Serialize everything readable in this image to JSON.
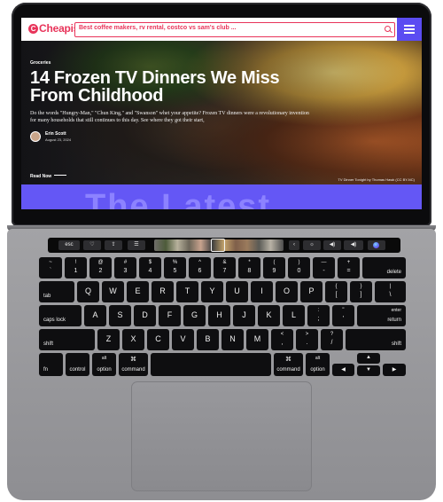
{
  "site": {
    "logo": "Cheapism",
    "logo_mark": "C",
    "search_value": "Best coffee makers, rv rental, costco vs sam's club ...",
    "accent_color": "#e8345a",
    "brand_color": "#5b4cf2"
  },
  "hero": {
    "category": "Groceries",
    "headline": "14 Frozen TV Dinners We Miss From Childhood",
    "dek": "Do the words \"Hungry-Man,\" \"Chun King,\" and \"Swanson\" whet your appetite? Frozen TV dinners were a revolutionary invention for many households that still continues to this day. See where they got their start,",
    "author": "Erin Scott",
    "date": "August 23, 2024",
    "cta": "Read Now",
    "caption": "TV Dinner Tonight by Thomas Hawk (CC BY-NC)"
  },
  "latest": {
    "heading": "The Latest"
  },
  "touch_bar": {
    "esc": "esc",
    "icons": [
      "heart-icon",
      "share-icon",
      "tabs-icon",
      "brightness-icon",
      "volume-icon",
      "mute-icon",
      "siri-icon"
    ],
    "heart": "♡",
    "share": "⇪",
    "tabs": "☰",
    "chevron": "‹",
    "brightness": "☼",
    "volume": "◀)",
    "mute": "◀)"
  },
  "keyboard": {
    "row1": [
      {
        "top": "~",
        "bot": "`"
      },
      {
        "top": "!",
        "bot": "1"
      },
      {
        "top": "@",
        "bot": "2"
      },
      {
        "top": "#",
        "bot": "3"
      },
      {
        "top": "$",
        "bot": "4"
      },
      {
        "top": "%",
        "bot": "5"
      },
      {
        "top": "^",
        "bot": "6"
      },
      {
        "top": "&",
        "bot": "7"
      },
      {
        "top": "*",
        "bot": "8"
      },
      {
        "top": "(",
        "bot": "9"
      },
      {
        "top": ")",
        "bot": "0"
      },
      {
        "top": "—",
        "bot": "-"
      },
      {
        "top": "+",
        "bot": "="
      }
    ],
    "delete": "delete",
    "tab": "tab",
    "row2": [
      "Q",
      "W",
      "E",
      "R",
      "T",
      "Y",
      "U",
      "I",
      "O",
      "P"
    ],
    "row2_brackets": [
      {
        "top": "{",
        "bot": "["
      },
      {
        "top": "}",
        "bot": "]"
      },
      {
        "top": "|",
        "bot": "\\"
      }
    ],
    "caps": "caps lock",
    "row3": [
      "A",
      "S",
      "D",
      "F",
      "G",
      "H",
      "J",
      "K",
      "L"
    ],
    "row3_punct": [
      {
        "top": ":",
        "bot": ";"
      },
      {
        "top": "\"",
        "bot": "'"
      }
    ],
    "enter": "enter",
    "return": "return",
    "shift": "shift",
    "row4": [
      "Z",
      "X",
      "C",
      "V",
      "B",
      "N",
      "M"
    ],
    "row4_punct": [
      {
        "top": "<",
        "bot": ","
      },
      {
        "top": ">",
        "bot": "."
      },
      {
        "top": "?",
        "bot": "/"
      }
    ],
    "fn": "fn",
    "control": "control",
    "option": "option",
    "alt": "alt",
    "command": "command",
    "cmd_symbol": "⌘",
    "arrow_left": "◀",
    "arrow_up": "▲",
    "arrow_down": "▼",
    "arrow_right": "▶"
  }
}
